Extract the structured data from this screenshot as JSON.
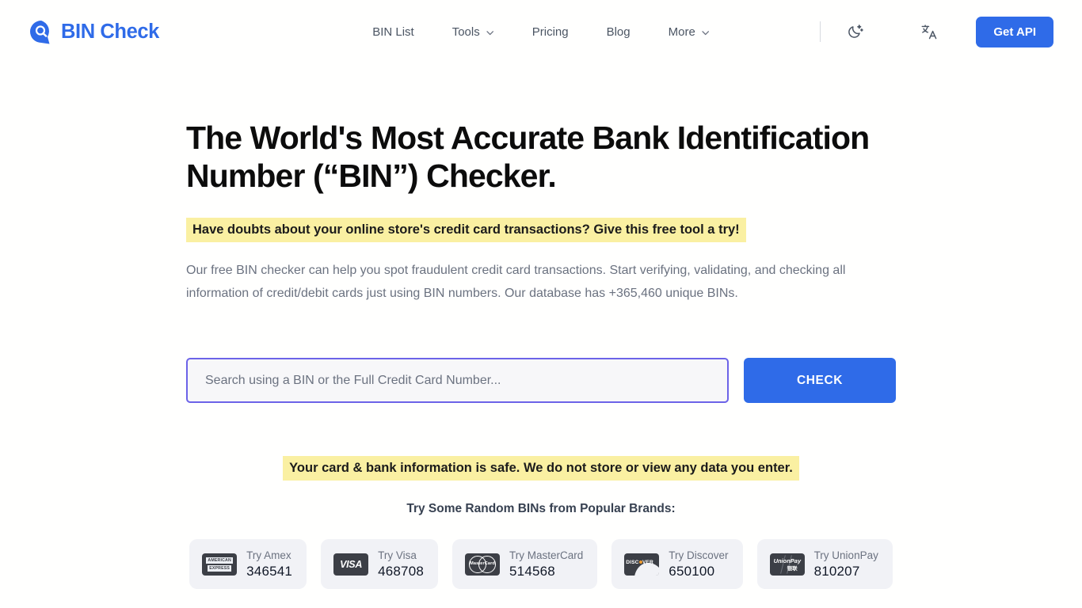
{
  "brand": {
    "name": "BIN Check",
    "logo_icon": "search-bubble-icon",
    "color": "#2F6BE8"
  },
  "nav": {
    "items": [
      {
        "label": "BIN List",
        "has_dropdown": false
      },
      {
        "label": "Tools",
        "has_dropdown": true
      },
      {
        "label": "Pricing",
        "has_dropdown": false
      },
      {
        "label": "Blog",
        "has_dropdown": false
      },
      {
        "label": "More",
        "has_dropdown": true
      }
    ],
    "dark_mode_icon": "moon-stars-icon",
    "language_icon": "translate-icon",
    "cta_label": "Get API"
  },
  "hero": {
    "headline": "The World's Most Accurate Bank Identification Number (“BIN”) Checker.",
    "tagline": "Have doubts about your online store's credit card transactions? Give this free tool a try!",
    "description": "Our free BIN checker can help you spot fraudulent credit card transactions. Start verifying, validating, and checking all information of credit/debit cards just using BIN numbers. Our database has +365,460 unique BINs.",
    "highlight_color": "#FAF0A2"
  },
  "search": {
    "placeholder": "Search using a BIN or the Full Credit Card Number...",
    "value": "",
    "button_label": "CHECK",
    "border_color": "#6C63E8",
    "button_color": "#2F6BE8"
  },
  "safety_notice": "Your card & bank information is safe. We do not store or view any data you enter.",
  "brands": {
    "title": "Try Some Random BINs from Popular Brands:",
    "cards": [
      {
        "icon": "amex-logo-icon",
        "label": "Try Amex",
        "bin": "346541"
      },
      {
        "icon": "visa-logo-icon",
        "label": "Try Visa",
        "bin": "468708"
      },
      {
        "icon": "mastercard-logo-icon",
        "label": "Try MasterCard",
        "bin": "514568"
      },
      {
        "icon": "discover-logo-icon",
        "label": "Try Discover",
        "bin": "650100"
      },
      {
        "icon": "unionpay-logo-icon",
        "label": "Try UnionPay",
        "bin": "810207"
      }
    ]
  }
}
